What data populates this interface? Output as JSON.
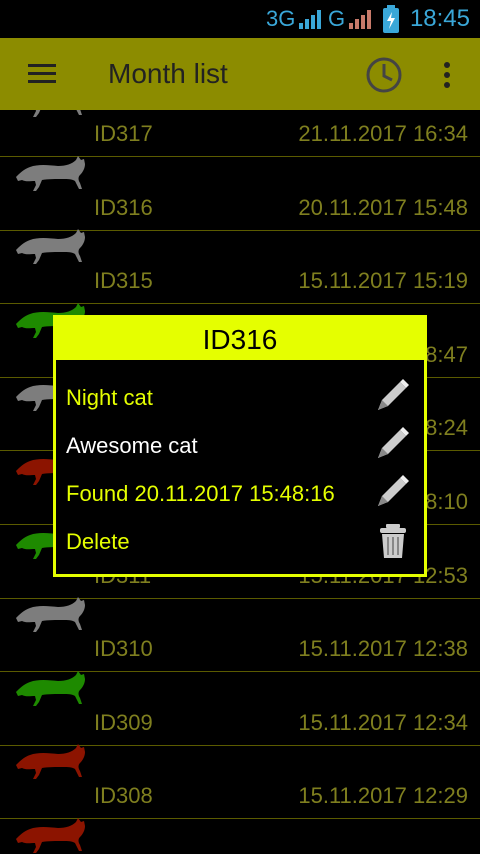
{
  "status": {
    "network": "3G",
    "network2": "G",
    "time": "18:45"
  },
  "appbar": {
    "title": "Month list"
  },
  "list": [
    {
      "id": "ID317",
      "datetime": "21.11.2017 16:34",
      "cat_color": "#7d7d7d"
    },
    {
      "id": "ID316",
      "datetime": "20.11.2017 15:48",
      "cat_color": "#7d7d7d"
    },
    {
      "id": "ID315",
      "datetime": "15.11.2017 15:19",
      "cat_color": "#7d7d7d"
    },
    {
      "id": "",
      "datetime": "",
      "cat_color": "#1e8a00"
    },
    {
      "id": "",
      "datetime": "",
      "cat_color": "#7d7d7d"
    },
    {
      "id": "",
      "datetime": "",
      "cat_color": "#8c1400"
    },
    {
      "id": "",
      "datetime": "",
      "cat_color": "#1e8a00"
    },
    {
      "id": "ID310",
      "datetime": "15.11.2017 12:38",
      "cat_color": "#7d7d7d"
    },
    {
      "id": "ID309",
      "datetime": "15.11.2017 12:34",
      "cat_color": "#1e8a00"
    },
    {
      "id": "ID308",
      "datetime": "15.11.2017 12:29",
      "cat_color": "#8c1400"
    },
    {
      "id": "",
      "datetime": "",
      "cat_color": "#8c1400"
    }
  ],
  "peek": {
    "r3": "8:47",
    "r4": "8:24",
    "r5": "8:10",
    "r6_id": "ID311",
    "r6_time": "15.11.2017 12:53"
  },
  "dialog": {
    "title": "ID316",
    "name": "Night cat",
    "description": "Awesome cat",
    "found": "Found 20.11.2017 15:48:16",
    "delete": "Delete"
  },
  "colors": {
    "appbar": "#8c8c00",
    "accent": "#e5ff00",
    "list_text": "#7f7f1f",
    "divider": "#5b5b00"
  }
}
